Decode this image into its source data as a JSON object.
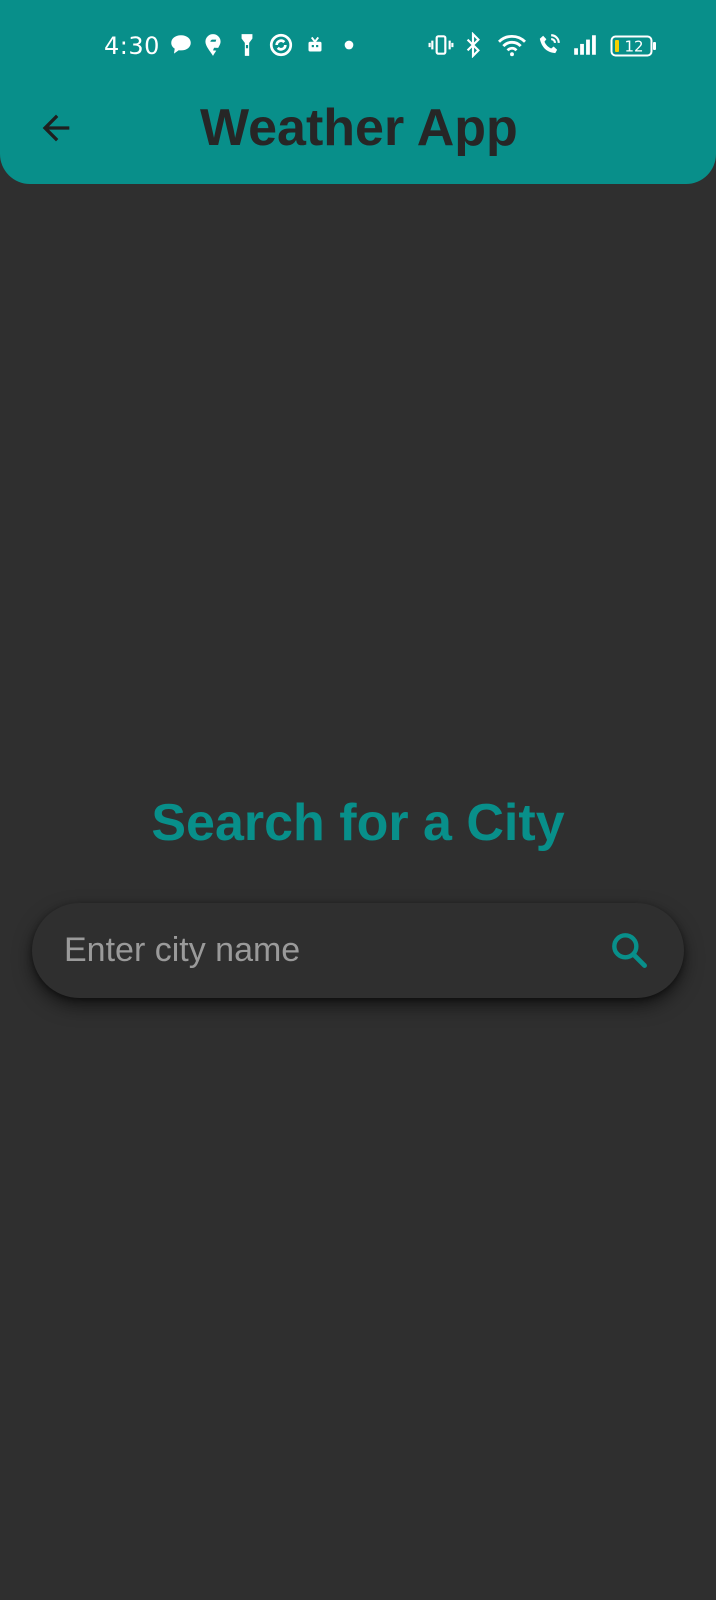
{
  "status_bar": {
    "time": "4:30",
    "battery_level": "12",
    "left_icons": [
      "chat-bubble-icon",
      "swiggy-icon",
      "flashlight-icon",
      "sync-circle-icon",
      "tv-icon",
      "dot-icon"
    ],
    "right_icons": [
      "vibrate-icon",
      "bluetooth-icon",
      "wifi-icon",
      "call-icon",
      "signal-icon",
      "battery-icon"
    ]
  },
  "app_bar": {
    "title": "Weather App",
    "back_icon": "arrow-back-icon",
    "color": "#088f8a"
  },
  "main": {
    "heading": "Search for a City",
    "search": {
      "placeholder": "Enter city name",
      "value": "",
      "icon": "search-icon"
    }
  },
  "colors": {
    "accent": "#088f8a",
    "background": "#2f2f2f",
    "title_text": "#262626"
  }
}
